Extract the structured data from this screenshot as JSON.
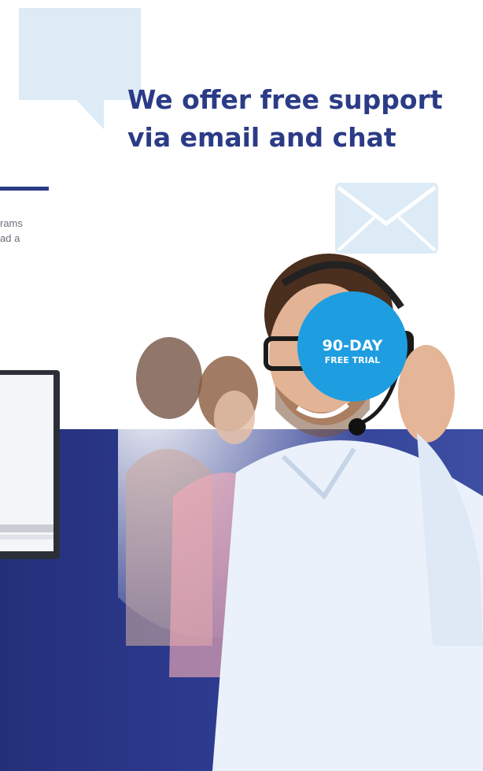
{
  "headline": "We offer free support via email and chat",
  "clipped_paragraph": "rams\nad a",
  "badge": {
    "line1": "90-DAY",
    "line2": "FREE TRIAL"
  },
  "colors": {
    "brand_navy": "#2b3b86",
    "badge_blue": "#1e9de0",
    "light_blue": "#dcebf6"
  },
  "icons": {
    "mail": "envelope-icon",
    "bubble": "speech-bubble-icon"
  }
}
